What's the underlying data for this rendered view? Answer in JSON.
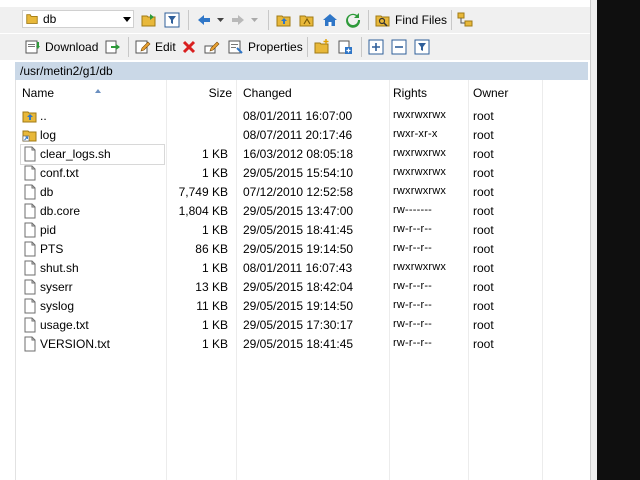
{
  "toolbar1": {
    "path_value": "db",
    "find_files_label": "Find Files"
  },
  "toolbar2": {
    "download_label": "Download",
    "edit_label": "Edit",
    "properties_label": "Properties"
  },
  "path_bar": {
    "path": "/usr/metin2/g1/db"
  },
  "columns": {
    "name": "Name",
    "size": "Size",
    "changed": "Changed",
    "rights": "Rights",
    "owner": "Owner"
  },
  "files": [
    {
      "name": "..",
      "size": "",
      "changed": "08/01/2011 16:07:00",
      "rights": "rwxrwxrwx",
      "owner": "root",
      "icon": "parent-folder-icon"
    },
    {
      "name": "log",
      "size": "",
      "changed": "08/07/2011 20:17:46",
      "rights": "rwxr-xr-x",
      "owner": "root",
      "icon": "folder-link-icon"
    },
    {
      "name": "clear_logs.sh",
      "size": "1 KB",
      "changed": "16/03/2012 08:05:18",
      "rights": "rwxrwxrwx",
      "owner": "root",
      "icon": "file-icon"
    },
    {
      "name": "conf.txt",
      "size": "1 KB",
      "changed": "29/05/2015 15:54:10",
      "rights": "rwxrwxrwx",
      "owner": "root",
      "icon": "file-icon"
    },
    {
      "name": "db",
      "size": "7,749 KB",
      "changed": "07/12/2010 12:52:58",
      "rights": "rwxrwxrwx",
      "owner": "root",
      "icon": "file-icon"
    },
    {
      "name": "db.core",
      "size": "1,804 KB",
      "changed": "29/05/2015 13:47:00",
      "rights": "rw-------",
      "owner": "root",
      "icon": "file-icon"
    },
    {
      "name": "pid",
      "size": "1 KB",
      "changed": "29/05/2015 18:41:45",
      "rights": "rw-r--r--",
      "owner": "root",
      "icon": "file-icon"
    },
    {
      "name": "PTS",
      "size": "86 KB",
      "changed": "29/05/2015 19:14:50",
      "rights": "rw-r--r--",
      "owner": "root",
      "icon": "file-icon"
    },
    {
      "name": "shut.sh",
      "size": "1 KB",
      "changed": "08/01/2011 16:07:43",
      "rights": "rwxrwxrwx",
      "owner": "root",
      "icon": "file-icon"
    },
    {
      "name": "syserr",
      "size": "13 KB",
      "changed": "29/05/2015 18:42:04",
      "rights": "rw-r--r--",
      "owner": "root",
      "icon": "file-icon"
    },
    {
      "name": "syslog",
      "size": "11 KB",
      "changed": "29/05/2015 19:14:50",
      "rights": "rw-r--r--",
      "owner": "root",
      "icon": "file-icon"
    },
    {
      "name": "usage.txt",
      "size": "1 KB",
      "changed": "29/05/2015 17:30:17",
      "rights": "rw-r--r--",
      "owner": "root",
      "icon": "file-icon"
    },
    {
      "name": "VERSION.txt",
      "size": "1 KB",
      "changed": "29/05/2015 18:41:45",
      "rights": "rw-r--r--",
      "owner": "root",
      "icon": "file-icon"
    }
  ],
  "colors": {
    "path_bar_bg": "#cad8e7",
    "toolbar_bg": "#f0f0f0",
    "delete_red": "#d92020",
    "folder_yellow": "#e8b83a",
    "nav_blue": "#2f76c7",
    "refresh_green": "#2e9a3a"
  }
}
